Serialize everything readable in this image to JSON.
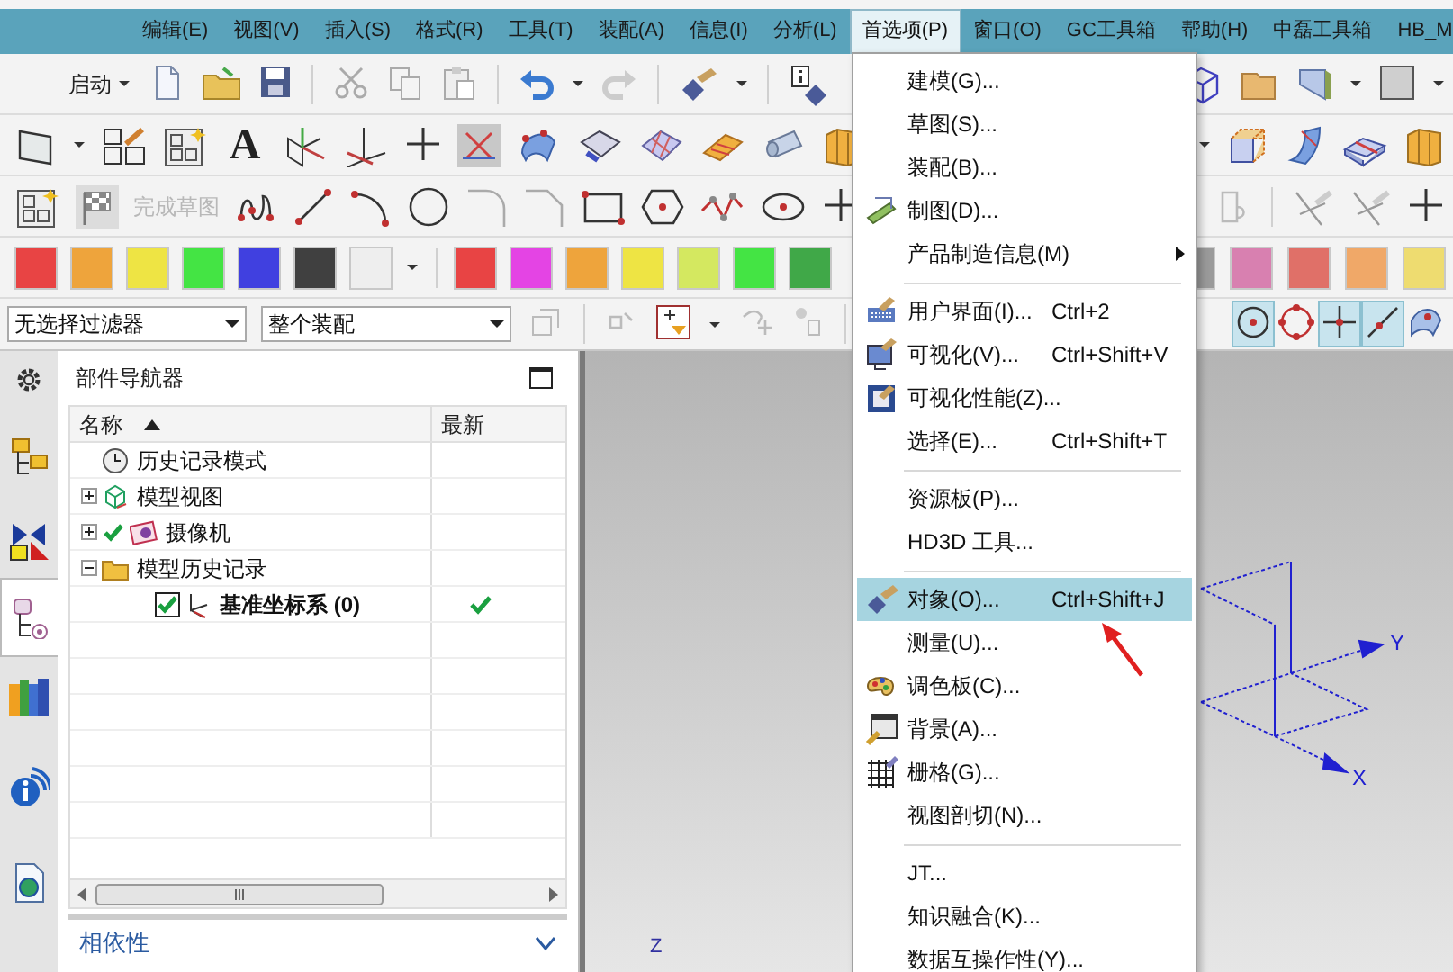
{
  "menu_bar": [
    {
      "label": "编辑(E)",
      "selected": false
    },
    {
      "label": "视图(V)",
      "selected": false
    },
    {
      "label": "插入(S)",
      "selected": false
    },
    {
      "label": "格式(R)",
      "selected": false
    },
    {
      "label": "工具(T)",
      "selected": false
    },
    {
      "label": "装配(A)",
      "selected": false
    },
    {
      "label": "信息(I)",
      "selected": false
    },
    {
      "label": "分析(L)",
      "selected": false
    },
    {
      "label": "首选项(P)",
      "selected": true
    },
    {
      "label": "窗口(O)",
      "selected": false
    },
    {
      "label": "GC工具箱",
      "selected": false
    },
    {
      "label": "帮助(H)",
      "selected": false
    },
    {
      "label": "中磊工具箱",
      "selected": false
    },
    {
      "label": "HB_M",
      "selected": false
    }
  ],
  "toolbar": {
    "start_button": "启动",
    "text_tool_glyph": "A",
    "finish_sketch": {
      "label": "完成草图",
      "disabled": true
    },
    "palette_left": [
      {
        "color": "#e84444"
      },
      {
        "color": "#eea43c"
      },
      {
        "color": "#eee444"
      },
      {
        "color": "#44e444"
      },
      {
        "color": "#4040e0"
      },
      {
        "color": "#404040"
      },
      {
        "color": "#eeeeee"
      }
    ],
    "palette_right": [
      {
        "color": "#e84444"
      },
      {
        "color": "#e444e4"
      },
      {
        "color": "#eea43c"
      },
      {
        "color": "#eee444"
      },
      {
        "color": "#d4e860"
      },
      {
        "color": "#44e444"
      },
      {
        "color": "#40a848"
      }
    ],
    "palette_far": [
      {
        "color": "#9a9a9a"
      },
      {
        "color": "#d880b0"
      },
      {
        "color": "#e07068"
      },
      {
        "color": "#f0a868"
      },
      {
        "color": "#eedc70"
      }
    ],
    "filters": [
      {
        "value": "无选择过滤器"
      },
      {
        "value": "整个装配"
      }
    ],
    "snap_toggles": [
      {
        "on": true
      },
      {
        "on": false
      },
      {
        "on": true
      },
      {
        "on": true
      },
      {
        "on": false
      }
    ]
  },
  "side_tabs": [
    {
      "selected": false
    },
    {
      "selected": false
    },
    {
      "selected": true
    },
    {
      "selected": false
    },
    {
      "selected": false
    },
    {
      "selected": false
    }
  ],
  "part_navigator": {
    "title": "部件导航器",
    "columns": [
      "名称",
      "最新"
    ],
    "tree": [
      {
        "label": "历史记录模式",
        "kind": "clock",
        "checked": false,
        "latest": false,
        "bold": false
      },
      {
        "label": "模型视图",
        "kind": "views",
        "expanded": false,
        "checked": false,
        "latest": false,
        "bold": false
      },
      {
        "label": "摄像机",
        "kind": "camera",
        "expanded": false,
        "checked": true,
        "latest": false,
        "bold": false
      },
      {
        "label": "模型历史记录",
        "kind": "folder",
        "expanded": true,
        "checked": false,
        "latest": false,
        "bold": false,
        "children": [
          {
            "label": "基准坐标系 (0)",
            "kind": "csys",
            "checked": true,
            "check_box": true,
            "latest": true,
            "bold": true
          }
        ]
      }
    ],
    "dependencies_panel": {
      "title": "相依性",
      "expanded": false
    }
  },
  "preferences_menu": {
    "items": [
      {
        "kind": "item",
        "label": "建模(G)...",
        "selected": false
      },
      {
        "kind": "item",
        "label": "草图(S)...",
        "selected": false
      },
      {
        "kind": "item",
        "label": "装配(B)...",
        "selected": false
      },
      {
        "kind": "item",
        "label": "制图(D)...",
        "selected": false
      },
      {
        "kind": "submenu",
        "label": "产品制造信息(M)",
        "selected": false
      },
      {
        "kind": "separator"
      },
      {
        "kind": "item",
        "label": "用户界面(I)...",
        "shortcut": "Ctrl+2",
        "selected": false
      },
      {
        "kind": "item",
        "label": "可视化(V)...",
        "shortcut": "Ctrl+Shift+V",
        "selected": false
      },
      {
        "kind": "item",
        "label": "可视化性能(Z)...",
        "selected": false
      },
      {
        "kind": "item",
        "label": "选择(E)...",
        "shortcut": "Ctrl+Shift+T",
        "selected": false
      },
      {
        "kind": "separator"
      },
      {
        "kind": "item",
        "label": "资源板(P)...",
        "selected": false
      },
      {
        "kind": "item",
        "label": "HD3D 工具...",
        "selected": false
      },
      {
        "kind": "separator"
      },
      {
        "kind": "item",
        "label": "对象(O)...",
        "shortcut": "Ctrl+Shift+J",
        "selected": true
      },
      {
        "kind": "item",
        "label": "测量(U)...",
        "selected": false
      },
      {
        "kind": "item",
        "label": "调色板(C)...",
        "selected": false
      },
      {
        "kind": "item",
        "label": "背景(A)...",
        "selected": false
      },
      {
        "kind": "item",
        "label": "栅格(G)...",
        "selected": false
      },
      {
        "kind": "item",
        "label": "视图剖切(N)...",
        "selected": false
      },
      {
        "kind": "separator"
      },
      {
        "kind": "item",
        "label": "JT...",
        "selected": false
      },
      {
        "kind": "item",
        "label": "知识融合(K)...",
        "selected": false
      },
      {
        "kind": "item",
        "label": "数据互操作性(Y)...",
        "selected": false
      }
    ]
  },
  "viewport": {
    "axis_labels": [
      "Y",
      "X",
      "Z"
    ]
  }
}
